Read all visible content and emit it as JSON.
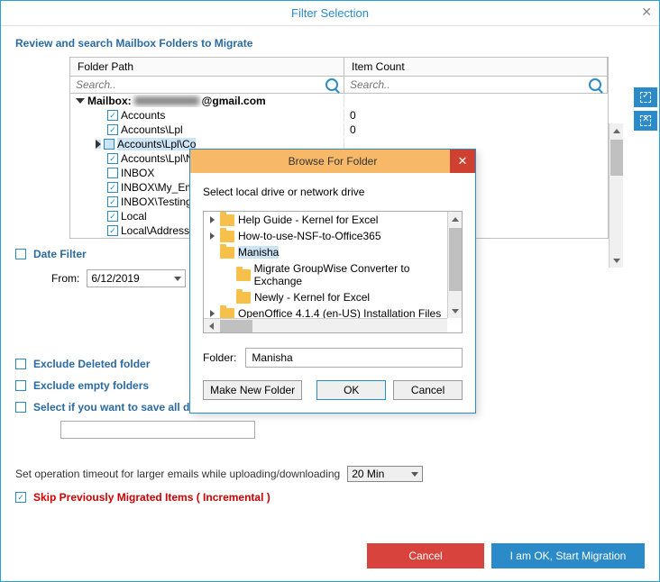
{
  "window": {
    "title": "Filter Selection"
  },
  "subhead": "Review and search Mailbox Folders to Migrate",
  "grid": {
    "col_folder": "Folder Path",
    "col_count": "Item Count",
    "search_placeholder": "Search..",
    "rows": [
      {
        "label": "Mailbox:",
        "suffix": "@gmail.com",
        "bold": true,
        "expand": "open",
        "indent": 0,
        "check": null,
        "count": ""
      },
      {
        "label": "Accounts",
        "indent": 1,
        "check": true,
        "count": "0"
      },
      {
        "label": "Accounts\\Lpl",
        "indent": 1,
        "check": true,
        "count": "0"
      },
      {
        "label": "Accounts\\Lpl\\Co",
        "indent": 1,
        "check": false,
        "expand": "closed",
        "selected": true,
        "count": ""
      },
      {
        "label": "Accounts\\Lpl\\No",
        "indent": 1,
        "check": true,
        "count": ""
      },
      {
        "label": "INBOX",
        "indent": 1,
        "check": false,
        "count": ""
      },
      {
        "label": "INBOX\\My_Email",
        "indent": 1,
        "check": true,
        "count": ""
      },
      {
        "label": "INBOX\\Testing M",
        "indent": 1,
        "check": true,
        "count": ""
      },
      {
        "label": "Local",
        "indent": 1,
        "check": true,
        "count": ""
      },
      {
        "label": "Local\\Address Bo",
        "indent": 1,
        "check": true,
        "count": ""
      }
    ]
  },
  "date_filter": {
    "label": "Date Filter",
    "from_label": "From:",
    "from_value": "6/12/2019"
  },
  "opts": {
    "exclude_deleted": "Exclude Deleted folder",
    "exclude_empty": "Exclude empty folders",
    "save_all": "Select if you want to save all dat"
  },
  "timeout": {
    "label": "Set operation timeout for larger emails while uploading/downloading",
    "value": "20 Min"
  },
  "skip": "Skip Previously Migrated Items ( Incremental )",
  "footer": {
    "cancel": "Cancel",
    "ok": "I am OK, Start Migration"
  },
  "modal": {
    "title": "Browse For Folder",
    "hint": "Select local drive or network drive",
    "items": [
      {
        "label": "Help Guide - Kernel for Excel",
        "tri": true
      },
      {
        "label": "How-to-use-NSF-to-Office365",
        "tri": true
      },
      {
        "label": "Manisha",
        "tri": false,
        "selected": true
      },
      {
        "label": "Migrate GroupWise Converter to Exchange",
        "tri": false,
        "pad": true
      },
      {
        "label": "Newly - Kernel for Excel",
        "tri": false,
        "pad": true
      },
      {
        "label": "OpenOffice 4.1.4 (en-US) Installation Files",
        "tri": true
      }
    ],
    "folder_label": "Folder:",
    "folder_value": "Manisha",
    "make": "Make New Folder",
    "ok": "OK",
    "cancel": "Cancel"
  }
}
